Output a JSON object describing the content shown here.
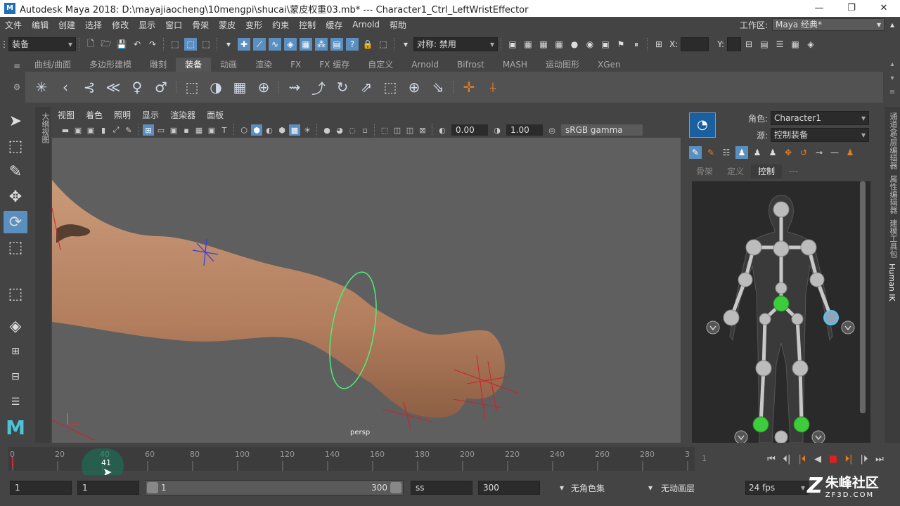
{
  "window": {
    "title": "Autodesk Maya 2018: D:\\mayajiaocheng\\10mengpi\\shucai\\蒙皮权重03.mb*   ---   Character1_Ctrl_LeftWristEffector",
    "app_icon": "M"
  },
  "menubar": {
    "items": [
      "文件",
      "编辑",
      "创建",
      "选择",
      "修改",
      "显示",
      "窗口",
      "骨架",
      "蒙皮",
      "变形",
      "约束",
      "控制",
      "缓存",
      "Arnold",
      "帮助"
    ],
    "workspace_label": "工作区:",
    "workspace_value": "Maya 经典*"
  },
  "statusline": {
    "mode": "装备",
    "symmetry": "对称: 禁用",
    "x_label": "X:",
    "y_label": "Y:"
  },
  "shelf": {
    "tabs": [
      "曲线/曲面",
      "多边形建模",
      "雕刻",
      "装备",
      "动画",
      "渲染",
      "FX",
      "FX 缓存",
      "自定义",
      "Arnold",
      "Bifrost",
      "MASH",
      "运动图形",
      "XGen"
    ],
    "active_tab": "装备"
  },
  "toolbox": {
    "tools": [
      "select-tool",
      "lasso-tool",
      "paint-select-tool",
      "move-tool",
      "rotate-tool",
      "scale-tool"
    ],
    "active": "rotate-tool"
  },
  "outliner_tab": "大纲视图",
  "viewport": {
    "menu": [
      "视图",
      "着色",
      "照明",
      "显示",
      "渲染器",
      "面板"
    ],
    "exposure": "0.00",
    "gamma_value": "1.00",
    "color_space": "sRGB gamma",
    "camera": "persp"
  },
  "hik": {
    "character_label": "角色:",
    "character_value": "Character1",
    "source_label": "源:",
    "source_value": "控制装备",
    "tabs": [
      "骨架",
      "定义",
      "控制",
      "---"
    ],
    "active_tab": "控制"
  },
  "side_tabs": [
    "通道盒/层编辑器",
    "属性编辑器",
    "建模工具包",
    "Human IK"
  ],
  "timeline": {
    "ticks": [
      "0",
      "20",
      "40",
      "60",
      "80",
      "100",
      "120",
      "140",
      "160",
      "180",
      "200",
      "220",
      "240",
      "260",
      "280",
      "3"
    ],
    "current_frame": "41",
    "end_marker": "1"
  },
  "range": {
    "start": "1",
    "playback_start": "1",
    "slider_start": "1",
    "slider_end": "300",
    "playback_end": "ss",
    "end": "300",
    "character_set": "无角色集",
    "anim_layer": "无动画层",
    "fps": "24 fps"
  },
  "watermark": {
    "brand": "朱峰社区",
    "url": "ZF3D.COM"
  }
}
